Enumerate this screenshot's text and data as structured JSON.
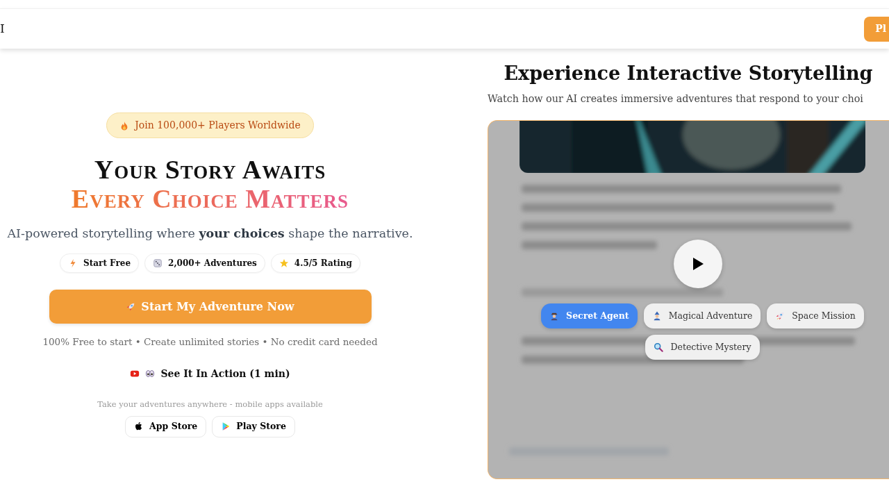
{
  "navbar": {
    "brand": "I",
    "button": "Pl"
  },
  "hero": {
    "badge": "Join 100,000+ Players Worldwide",
    "title_line_1": "Your Story Awaits",
    "title_line_2": "Every Choice Matters",
    "subtitle": "AI-powered storytelling where **your choices** shape the narrative.",
    "features": [
      {
        "label": "Start Free",
        "kind": "bolt"
      },
      {
        "label": "2,000+ Adventures",
        "kind": "dice"
      },
      {
        "label": "4.5/5 Rating",
        "kind": "star"
      }
    ],
    "cta": "Start My Adventure Now",
    "cta_note": "100% Free to start • Create unlimited stories • No credit card needed",
    "video_link": "See It In Action (1 min)",
    "apps_note": "Take your adventures anywhere - mobile apps available",
    "app_buttons": [
      {
        "label": "App Store",
        "kind": "apple"
      },
      {
        "label": "Play Store",
        "kind": "play"
      }
    ]
  },
  "demo": {
    "heading": "Experience Interactive Storytelling",
    "subheading": "Watch how our AI creates immersive adventures that respond to your choi",
    "choices": [
      {
        "label": "Secret Agent",
        "kind": "agent",
        "selected": true
      },
      {
        "label": "Magical Adventure",
        "kind": "mage",
        "selected": false
      },
      {
        "label": "Space Mission",
        "kind": "rocket",
        "selected": false
      },
      {
        "label": "Detective Mystery",
        "kind": "magnifier",
        "selected": false
      }
    ]
  }
}
